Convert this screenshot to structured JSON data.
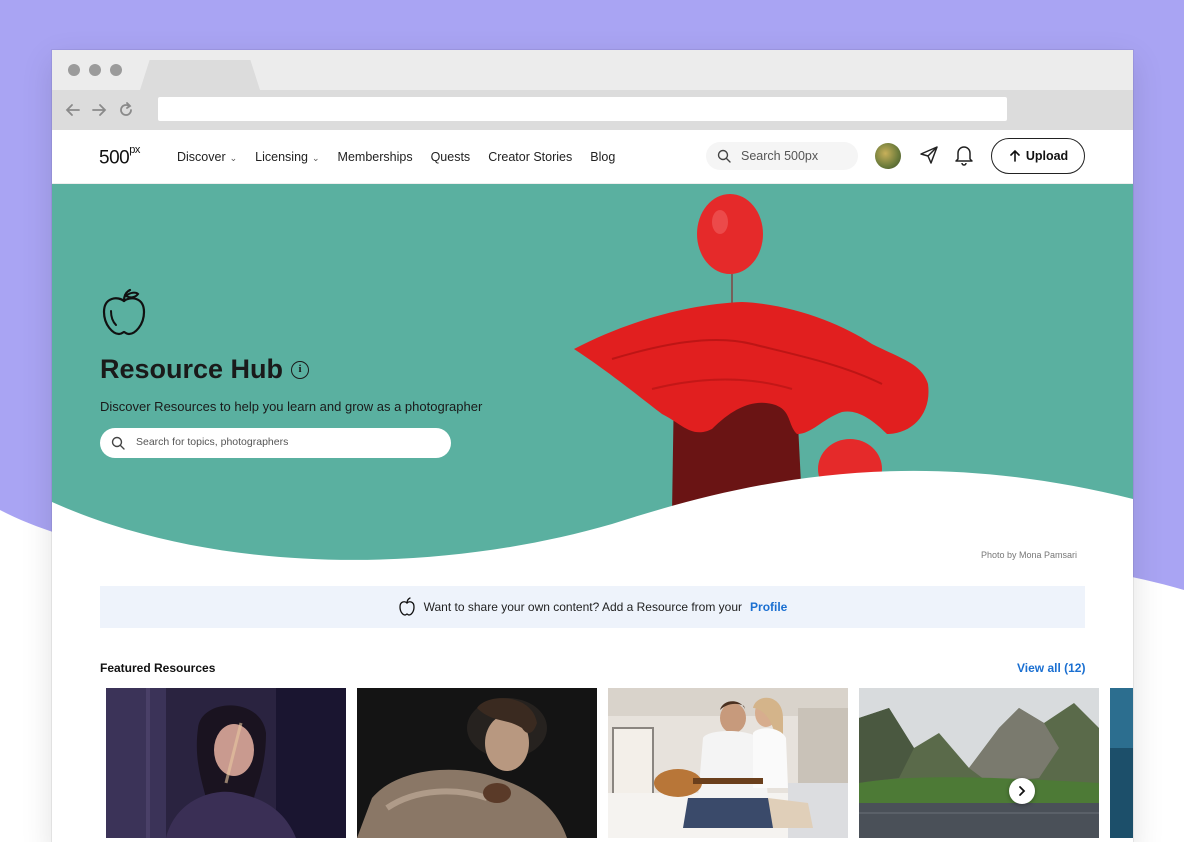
{
  "header": {
    "logo": "500",
    "logo_suffix": "px",
    "menu": [
      {
        "label": "Discover",
        "has_dropdown": true
      },
      {
        "label": "Licensing",
        "has_dropdown": true
      },
      {
        "label": "Memberships",
        "has_dropdown": false
      },
      {
        "label": "Quests",
        "has_dropdown": false
      },
      {
        "label": "Creator Stories",
        "has_dropdown": false
      },
      {
        "label": "Blog",
        "has_dropdown": false
      }
    ],
    "search_placeholder": "Search 500px",
    "upload_label": "Upload"
  },
  "hero": {
    "title": "Resource Hub",
    "subtitle": "Discover Resources to help you learn and grow as a photographer",
    "search_placeholder": "Search for topics, photographers",
    "photo_credit": "Photo by Mona Pamsari",
    "background_color": "#5ab0a0"
  },
  "banner": {
    "text": "Want to share your own content? Add a Resource from your",
    "link": "Profile"
  },
  "featured": {
    "title": "Featured Resources",
    "view_all": "View all (12)"
  },
  "icons": {
    "back": "arrow-left-icon",
    "forward": "arrow-right-icon",
    "reload": "reload-icon",
    "search": "search-icon",
    "send": "paper-plane-icon",
    "bell": "bell-icon",
    "upload": "arrow-up-icon",
    "apple": "apple-icon",
    "info": "info-icon",
    "next": "chevron-right-icon"
  },
  "colors": {
    "accent_link": "#1a6fd1",
    "page_background": "#a9a4f3"
  }
}
